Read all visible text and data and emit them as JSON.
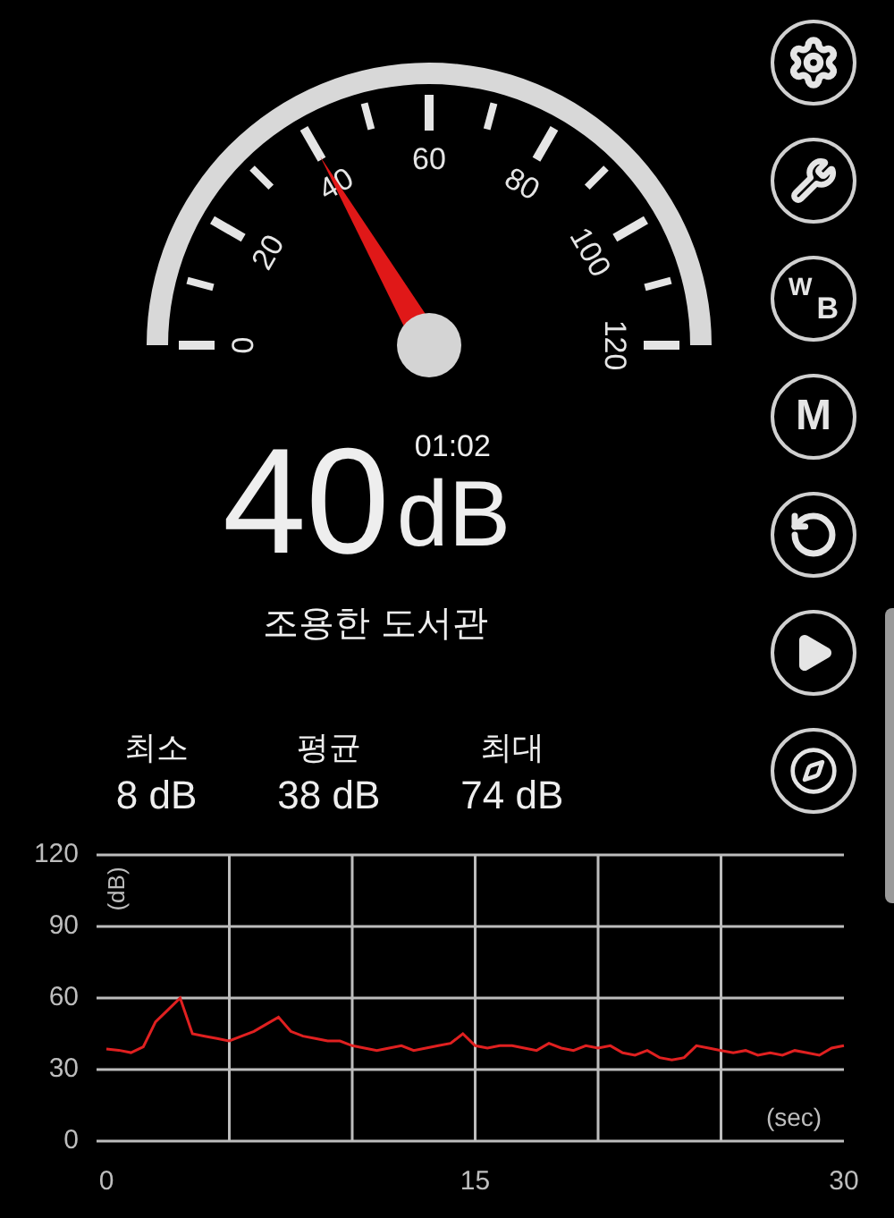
{
  "gauge": {
    "labels": [
      "0",
      "20",
      "40",
      "60",
      "80",
      "100",
      "120"
    ]
  },
  "readout": {
    "value": "40",
    "unit": "dB",
    "time": "01:02",
    "description": "조용한 도서관"
  },
  "stats": [
    {
      "label": "최소",
      "value": "8 dB"
    },
    {
      "label": "평균",
      "value": "38 dB"
    },
    {
      "label": "최대",
      "value": "74 dB"
    }
  ],
  "buttons": [
    {
      "kind": "settings"
    },
    {
      "kind": "wrench"
    },
    {
      "kind": "wb",
      "label": "W",
      "sub": "B"
    },
    {
      "kind": "text",
      "label": "M"
    },
    {
      "kind": "reset"
    },
    {
      "kind": "play"
    },
    {
      "kind": "compass"
    }
  ],
  "chart": {
    "chart_data": {
      "type": "line",
      "xlabel": "(sec)",
      "ylabel": "(dB)",
      "xlim": [
        -0.4,
        30
      ],
      "grid": true,
      "ylim": [
        0,
        120
      ],
      "xticks": [
        0,
        15,
        30
      ],
      "yticks": [
        0,
        30,
        60,
        90,
        120
      ],
      "x": [
        0,
        0.5,
        1,
        1.5,
        2,
        2.5,
        3,
        3.5,
        4,
        4.5,
        5,
        5.5,
        6,
        6.5,
        7,
        7.5,
        8,
        8.5,
        9,
        9.5,
        10,
        10.5,
        11,
        11.5,
        12,
        12.5,
        13,
        13.5,
        14,
        14.5,
        15,
        15.5,
        16,
        16.5,
        17,
        17.5,
        18,
        18.5,
        19,
        19.5,
        20,
        20.5,
        21,
        21.5,
        22,
        22.5,
        23,
        23.5,
        24,
        24.5,
        25,
        25.5,
        26,
        26.5,
        27,
        27.5,
        28,
        28.5,
        29,
        29.5,
        30
      ],
      "series": [
        {
          "color": "#e02020",
          "values": [
            38.6,
            38.1,
            37.1,
            39.5,
            50,
            55,
            60,
            45,
            44,
            43,
            42,
            44,
            46,
            49,
            52,
            46,
            44,
            43,
            42,
            42,
            40,
            39,
            38,
            39,
            40,
            38,
            39,
            40,
            41,
            45,
            40,
            39,
            40,
            40,
            39,
            38,
            41,
            39,
            38,
            40,
            39,
            40,
            37,
            36,
            38,
            35,
            34,
            35,
            40,
            39,
            38,
            37,
            38,
            36,
            37,
            36,
            38,
            37,
            36,
            39,
            40
          ]
        }
      ]
    }
  }
}
